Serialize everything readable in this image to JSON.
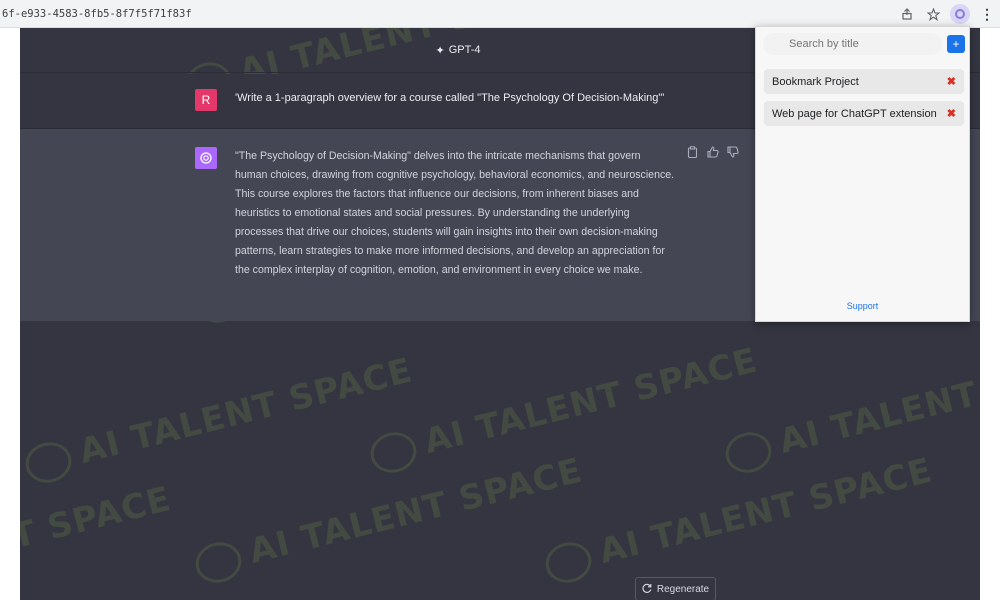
{
  "browser": {
    "url": "6f-e933-4583-8fb5-8f7f5f71f83f",
    "icons": [
      "share-icon",
      "star-icon",
      "extension-icon",
      "kebab-menu-icon"
    ]
  },
  "topbar": {
    "model_label": "GPT-4"
  },
  "conversation": {
    "user": {
      "avatar_letter": "R",
      "avatar_color": "#e4386a",
      "text": "'Write a 1-paragraph overview for a course called \"The Psychology Of Decision-Making\"'"
    },
    "assistant": {
      "avatar_color": "#ab68ff",
      "text": "\"The Psychology of Decision-Making\" delves into the intricate mechanisms that govern human choices, drawing from cognitive psychology, behavioral economics, and neuroscience. This course explores the factors that influence our decisions, from inherent biases and heuristics to emotional states and social pressures. By understanding the underlying processes that drive our choices, students will gain insights into their own decision-making patterns, learn strategies to make more informed decisions, and develop an appreciation for the complex interplay of cognition, emotion, and environment in every choice we make."
    },
    "regenerate_label": "Regenerate"
  },
  "watermark": {
    "text": "AI TALENT SPACE",
    "fragment": "T SPACE"
  },
  "popup": {
    "search_placeholder": "Search by title",
    "add_label": "+",
    "bookmarks": [
      {
        "title": "Bookmark Project",
        "delete_label": "✖"
      },
      {
        "title": "Web page for ChatGPT extension",
        "delete_label": "✖"
      }
    ],
    "support_label": "Support"
  },
  "colors": {
    "app_bg": "#343541",
    "assistant_bg": "#444654",
    "accent_blue": "#1a73e8",
    "delete_red": "#d93025"
  }
}
